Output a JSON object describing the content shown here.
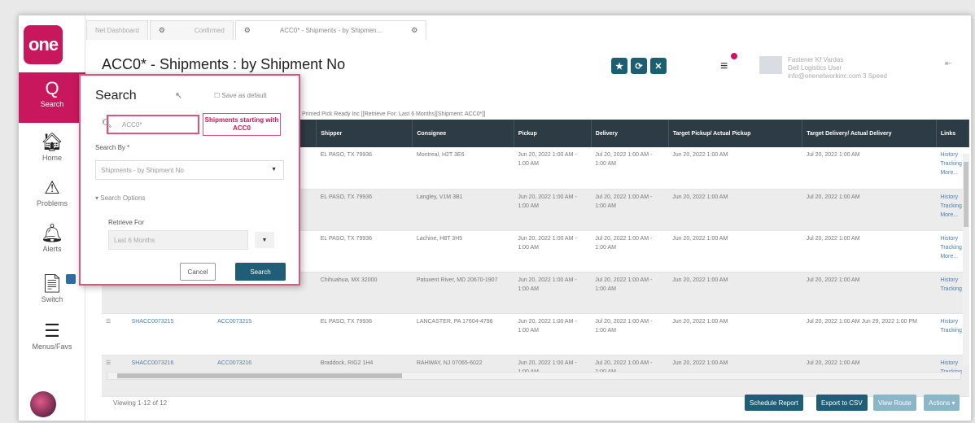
{
  "nav": {
    "logo": "one",
    "items": [
      {
        "icon": "Q",
        "label": "Search"
      },
      {
        "icon": "🏠︎",
        "label": "Home"
      },
      {
        "icon": "⚠︎",
        "label": "Problems"
      },
      {
        "icon": "🔔︎",
        "label": "Alerts"
      },
      {
        "icon": "📄︎",
        "label": "Switch"
      },
      {
        "icon": "☰",
        "label": "Menus/Favs"
      }
    ]
  },
  "tabs": [
    {
      "label": "Net Dashboard",
      "icon": "⚙"
    },
    {
      "label": "Confirmed",
      "icon": "⚙"
    },
    {
      "label": "ACC0* - Shipments - by Shipmen...",
      "icon": "⚙"
    }
  ],
  "header": {
    "title": "ACC0* - Shipments : by Shipment No",
    "user_line1": "Fastener Kf Vardas",
    "user_line2": "Dell Logistics User",
    "user_line3": "info@onenetworkinc.com 3 Speed"
  },
  "filter_line": "Primed Pick Ready Inc   [[Retrieve For: Last 6 Months][Shipment: ACC0*]]",
  "table": {
    "headers": [
      "",
      "",
      "",
      "Shipper",
      "Consignee",
      "Pickup",
      "Delivery",
      "Target Pickup/ Actual Pickup",
      "Target Delivery/ Actual Delivery",
      "Links"
    ],
    "rows": [
      {
        "c0": "",
        "c1": "",
        "c2": "",
        "shipper": "EL PASO, TX 79936",
        "consignee": "Montreal, H2T 3E6",
        "pickup": "Jun 20, 2022 1:00 AM - 1:00 AM",
        "delivery": "Jul 20, 2022 1:00 AM - 1:00 AM",
        "tp": "Jun 20, 2022 1:00 AM",
        "td": "Jul 20, 2022 1:00 AM",
        "links": "History Tracking More..."
      },
      {
        "c0": "",
        "c1": "",
        "c2": "",
        "shipper": "EL PASO, TX 79936",
        "consignee": "Langley, V1M 3B1",
        "pickup": "Jun 20, 2022 1:00 AM - 1:00 AM",
        "delivery": "Jul 20, 2022 1:00 AM - 1:00 AM",
        "tp": "Jun 20, 2022 1:00 AM",
        "td": "Jul 20, 2022 1:00 AM",
        "links": "History Tracking More..."
      },
      {
        "c0": "",
        "c1": "",
        "c2": "",
        "shipper": "EL PASO, TX 79936",
        "consignee": "Lachine, H8T 3H5",
        "pickup": "Jun 20, 2022 1:00 AM - 1:00 AM",
        "delivery": "Jul 20, 2022 1:00 AM - 1:00 AM",
        "tp": "Jun 20, 2022 1:00 AM",
        "td": "Jul 20, 2022 1:00 AM",
        "links": "History Tracking More..."
      },
      {
        "c0": "",
        "c1": "",
        "c2": "",
        "shipper": "Chihuahua, MX 32000",
        "consignee": "Patuxent River, MD 20670-1907",
        "pickup": "Jun 20, 2022 1:00 AM - 1:00 AM",
        "delivery": "Jul 20, 2022 1:00 AM - 1:00 AM",
        "tp": "Jun 20, 2022 1:00 AM",
        "td": "Jul 20, 2022 1:00 AM",
        "links": "History Tracking"
      },
      {
        "c0": "☰",
        "c1": "SHACC0073215",
        "c2": "ACC0073215",
        "shipper": "EL PASO, TX 79936",
        "consignee": "LANCASTER, PA 17604-4796",
        "pickup": "Jun 20, 2022 1:00 AM - 1:00 AM",
        "delivery": "Jul 20, 2022 1:00 AM - 1:00 AM",
        "tp": "Jun 20, 2022 1:00 AM",
        "td": "Jul 20, 2022 1:00 AM Jun 29, 2022 1:00 PM",
        "links": "History Tracking"
      },
      {
        "c0": "☰",
        "c1": "SHACC0073216",
        "c2": "ACC0073216",
        "shipper": "Braddock, RIG2 1H4",
        "consignee": "RAHWAY, NJ 07065-6022",
        "pickup": "Jun 20, 2022 1:00 AM - 1:00 AM",
        "delivery": "Jul 20, 2022 1:00 AM - 1:00 AM",
        "tp": "Jun 20, 2022 1:00 AM",
        "td": "Jul 20, 2022 1:00 AM",
        "links": "History Tracking"
      }
    ]
  },
  "footer": {
    "viewing": "Viewing 1-12 of 12",
    "buttons": [
      "Schedule Report",
      "Export to CSV",
      "View Route",
      "Actions ▾"
    ]
  },
  "search_panel": {
    "title": "Search",
    "save_default": "Save as default",
    "input_value": "ACC0*",
    "callout": "Shipments starting with ACC0",
    "search_by_label": "Search By",
    "required_mark": "*",
    "search_by_value": "Shipments - by Shipment No",
    "options_toggle": "Search Options",
    "retrieve_label": "Retrieve For",
    "retrieve_value": "Last 6 Months",
    "cancel": "Cancel",
    "search": "Search"
  }
}
